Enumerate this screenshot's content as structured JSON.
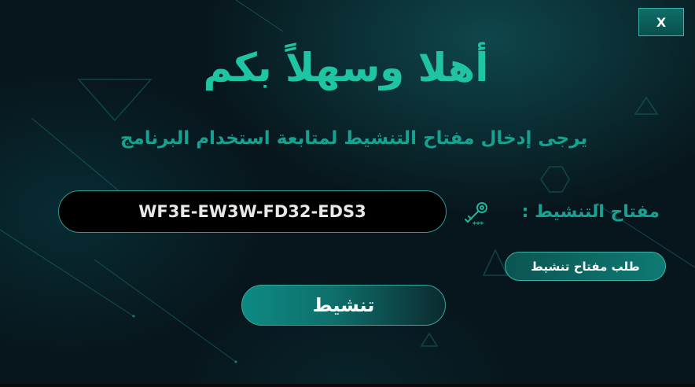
{
  "window": {
    "close_label": "X"
  },
  "header": {
    "title": "أهلا وسهلاً بكم",
    "subtitle": "يرجى إدخال مفتاح التنشيط لمتابعة استخدام البرنامج"
  },
  "form": {
    "key_label": "مفتاح التنشيط :",
    "key_value": "WF3E-EW3W-FD32-EDS3",
    "key_icon": "key-icon",
    "request_key_label": "طلب مفتاح تنشيط",
    "activate_label": "تنشيط"
  },
  "colors": {
    "accent": "#1fc4a3",
    "accent_dark": "#17a191",
    "background": "#07161c",
    "button": "#0f7a73"
  }
}
